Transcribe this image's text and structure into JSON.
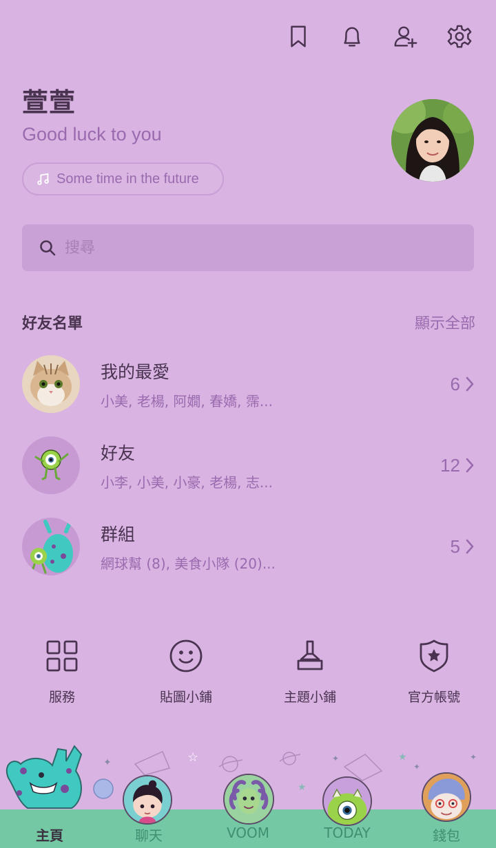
{
  "top_icons": [
    "bookmark-icon",
    "bell-icon",
    "add-friend-icon",
    "settings-icon"
  ],
  "profile": {
    "name": "萱萱",
    "status": "Good luck to you",
    "music": "Some time in the future"
  },
  "search": {
    "placeholder": "搜尋"
  },
  "friends_section": {
    "title": "好友名單",
    "show_all": "顯示全部",
    "rows": [
      {
        "title": "我的最愛",
        "members": "小美, 老楊, 阿嫺, 春嬌, 霈...",
        "count": "6"
      },
      {
        "title": "好友",
        "members": "小李, 小美, 小豪, 老楊, 志...",
        "count": "12"
      },
      {
        "title": "群組",
        "members": "網球幫 (8), 美食小隊 (20)...",
        "count": "5"
      }
    ]
  },
  "services": [
    {
      "label": "服務",
      "icon": "grid-icon"
    },
    {
      "label": "貼圖小鋪",
      "icon": "smiley-icon"
    },
    {
      "label": "主題小鋪",
      "icon": "brush-icon"
    },
    {
      "label": "官方帳號",
      "icon": "shield-star-icon"
    }
  ],
  "tabs": [
    {
      "label": "主頁",
      "active": true
    },
    {
      "label": "聊天",
      "active": false
    },
    {
      "label": "VOOM",
      "active": false
    },
    {
      "label": "TODAY",
      "active": false
    },
    {
      "label": "錢包",
      "active": false
    }
  ],
  "colors": {
    "background": "#d9b4e2",
    "accent_text": "#9a6aae",
    "tabbar": "#74c9a4",
    "dark_text": "#4a3350"
  }
}
